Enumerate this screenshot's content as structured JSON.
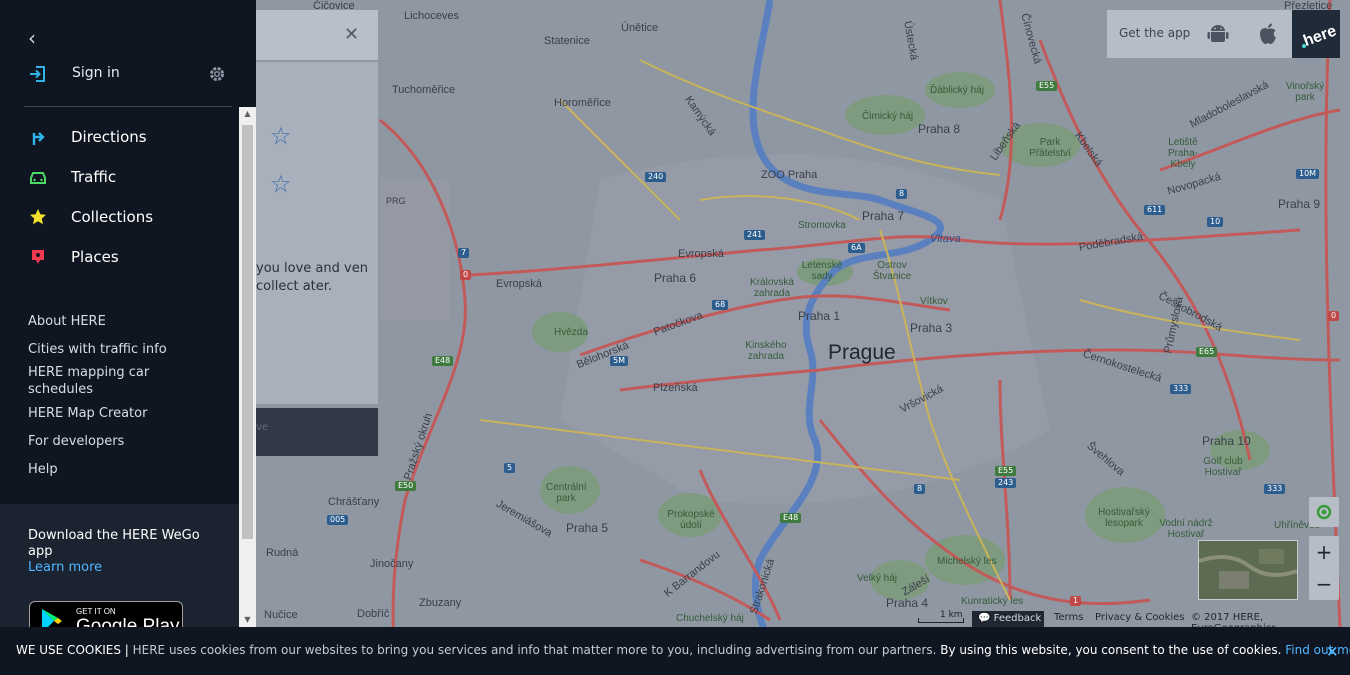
{
  "sidebar": {
    "back_icon": "chevron-left-icon",
    "sign_in": "Sign in",
    "main_items": [
      {
        "label": "Directions",
        "icon": "directions-icon",
        "color": "#2fb3e8"
      },
      {
        "label": "Traffic",
        "icon": "traffic-car-icon",
        "color": "#4cd964"
      },
      {
        "label": "Collections",
        "icon": "collections-star-icon",
        "color": "#f2e02a"
      },
      {
        "label": "Places",
        "icon": "places-pin-icon",
        "color": "#f03a52"
      }
    ],
    "links": [
      "About HERE",
      "Cities with traffic info",
      "HERE mapping car schedules",
      "HERE Map Creator",
      "For developers",
      "Help"
    ],
    "download": {
      "title": "Download the HERE WeGo app",
      "learn_more": "Learn more",
      "badge_small": "GET IT ON",
      "badge_large": "Google Play"
    }
  },
  "panel": {
    "text": "you love and ven collect ater.",
    "button_text": "ve"
  },
  "top_right": {
    "get_app": "Get the app",
    "android_icon": "android-icon",
    "apple_icon": "apple-icon",
    "logo_text": "here"
  },
  "map": {
    "city": "Prague",
    "labels": [
      {
        "t": "Lichoceves"
      },
      {
        "t": "Statenice"
      },
      {
        "t": "Únětice"
      },
      {
        "t": "Tuchoměřice"
      },
      {
        "t": "Horoměřice"
      },
      {
        "t": "Praha 8"
      },
      {
        "t": "Ďáblický háj"
      },
      {
        "t": "Čimický háj"
      },
      {
        "t": "Park Přátelství"
      },
      {
        "t": "ZOO Praha"
      },
      {
        "t": "Praha 7"
      },
      {
        "t": "Stromovka"
      },
      {
        "t": "Vltava"
      },
      {
        "t": "Letenské sady"
      },
      {
        "t": "Ostrov Štvanice"
      },
      {
        "t": "Praha 6"
      },
      {
        "t": "Královská zahrada"
      },
      {
        "t": "Vítkov"
      },
      {
        "t": "Praha 1"
      },
      {
        "t": "Praha 3"
      },
      {
        "t": "Hvězda"
      },
      {
        "t": "Kinského zahrada"
      },
      {
        "t": "Plzeňská"
      },
      {
        "t": "Vršovická"
      },
      {
        "t": "Centrální park"
      },
      {
        "t": "Praha 5"
      },
      {
        "t": "Prokopské údolí"
      },
      {
        "t": "Chrášťany"
      },
      {
        "t": "Rudná"
      },
      {
        "t": "Jinočany"
      },
      {
        "t": "Zbuzany"
      },
      {
        "t": "Nučice"
      },
      {
        "t": "Dobříč"
      },
      {
        "t": "Michelský les"
      },
      {
        "t": "Praha 4"
      },
      {
        "t": "Kunratický les"
      },
      {
        "t": "Hostivařský lesopark"
      },
      {
        "t": "Vodní nádrž Hostivař"
      },
      {
        "t": "Praha 10"
      },
      {
        "t": "Golf club Hostivař"
      },
      {
        "t": "Praha 9"
      },
      {
        "t": "Letiště Praha-Kbely"
      },
      {
        "t": "Vinořský park"
      },
      {
        "t": "Přezletice"
      },
      {
        "t": "Čičovice"
      },
      {
        "t": "Evropská"
      },
      {
        "t": "Bělohorská"
      },
      {
        "t": "Patočkova"
      },
      {
        "t": "Pražský okruh"
      },
      {
        "t": "Jeremiášova"
      },
      {
        "t": "K Barrandovu"
      },
      {
        "t": "Strakonická"
      },
      {
        "t": "Chuchelský háj"
      },
      {
        "t": "Velký háj"
      },
      {
        "t": "Záleší"
      },
      {
        "t": "Libeňská"
      },
      {
        "t": "Kbelská"
      },
      {
        "t": "Mladoboleslavská"
      },
      {
        "t": "Novopacká"
      },
      {
        "t": "Poděbradská"
      },
      {
        "t": "Českobrodská"
      },
      {
        "t": "Průmyslová"
      },
      {
        "t": "Černokostelecká"
      },
      {
        "t": "Švehlova"
      },
      {
        "t": "Kamýcká"
      },
      {
        "t": "Ústecká"
      },
      {
        "t": "Čínovecká"
      },
      {
        "t": "PRG"
      },
      {
        "t": "Uhříněves"
      },
      {
        "t": "Evropská"
      }
    ]
  },
  "controls": {
    "locate_icon": "locate-icon",
    "zoom_in": "+",
    "zoom_out": "−",
    "scale": "1 km",
    "feedback": "Feedback",
    "terms": "Terms",
    "privacy": "Privacy & Cookies",
    "copyright": "© 2017 HERE, EuroGeographics"
  },
  "cookie": {
    "title": "WE USE COOKIES",
    "separator": " | ",
    "body": "HERE uses cookies from our websites to bring you services and info that matter more to you, including advertising from our partners.",
    "consent": " By using this website, you consent to the use of cookies.",
    "find_out_more": "Find out more",
    "close": "×"
  }
}
